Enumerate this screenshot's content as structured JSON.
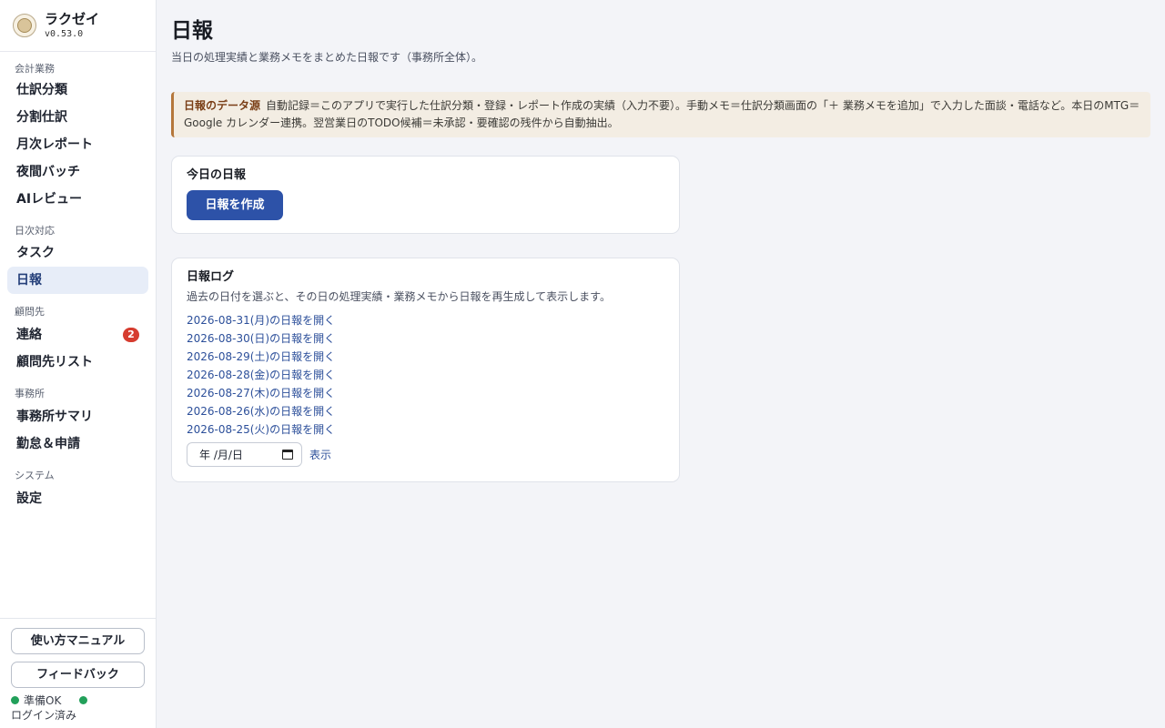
{
  "app": {
    "name": "ラクゼイ",
    "version": "v0.53.0"
  },
  "sidebar": {
    "sections": [
      {
        "label": "会計業務",
        "items": [
          {
            "label": "仕訳分類"
          },
          {
            "label": "分割仕訳"
          },
          {
            "label": "月次レポート"
          },
          {
            "label": "夜間バッチ"
          },
          {
            "label": "AIレビュー"
          }
        ]
      },
      {
        "label": "日次対応",
        "items": [
          {
            "label": "タスク"
          },
          {
            "label": "日報",
            "active": true
          }
        ]
      },
      {
        "label": "顧問先",
        "items": [
          {
            "label": "連絡",
            "badge": "2"
          },
          {
            "label": "顧問先リスト"
          }
        ]
      },
      {
        "label": "事務所",
        "items": [
          {
            "label": "事務所サマリ"
          },
          {
            "label": "勤怠＆申請"
          }
        ]
      },
      {
        "label": "システム",
        "items": [
          {
            "label": "設定"
          }
        ]
      }
    ],
    "footer": {
      "manual_button": "使い方マニュアル",
      "feedback_button": "フィードバック",
      "status_text": "準備OK",
      "login_text": "ログイン済み",
      "status_color": "#22a05a"
    }
  },
  "main": {
    "title": "日報",
    "subtitle": "当日の処理実績と業務メモをまとめた日報です（事務所全体）。",
    "notice": {
      "title": "日報のデータ源",
      "body": "自動記録＝このアプリで実行した仕訳分類・登録・レポート作成の実績（入力不要）。手動メモ＝仕訳分類画面の「＋ 業務メモを追加」で入力した面談・電話など。本日のMTG＝Google カレンダー連携。翌営業日のTODO候補＝未承認・要確認の残件から自動抽出。"
    },
    "today_card": {
      "title": "今日の日報",
      "button": "日報を作成"
    },
    "log_card": {
      "title": "日報ログ",
      "description": "過去の日付を選ぶと、その日の処理実績・業務メモから日報を再生成して表示します。",
      "links": [
        "2026-08-31(月)の日報を開く",
        "2026-08-30(日)の日報を開く",
        "2026-08-29(土)の日報を開く",
        "2026-08-28(金)の日報を開く",
        "2026-08-27(木)の日報を開く",
        "2026-08-26(水)の日報を開く",
        "2026-08-25(火)の日報を開く"
      ],
      "date_placeholder": "年 /月/日",
      "show_link": "表示"
    }
  },
  "colors": {
    "accent": "#2d52a8",
    "link": "#2c4f9a",
    "badge": "#d63c2f",
    "notice_border": "#b5773b",
    "notice_bg": "#f3ede3"
  }
}
